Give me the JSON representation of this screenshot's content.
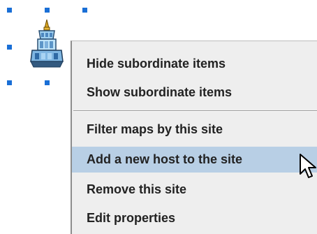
{
  "canvas": {
    "node_icon": "site-tower-icon",
    "selection_color": "#1a6fd6"
  },
  "context_menu": {
    "items": [
      {
        "label": "Hide subordinate items"
      },
      {
        "label": "Show subordinate items"
      },
      {
        "label": "Filter maps by this site"
      },
      {
        "label": "Add a new host to the site",
        "highlighted": true
      },
      {
        "label": "Remove this site"
      },
      {
        "label": "Edit properties"
      }
    ],
    "highlight_color": "#b8cfe5"
  },
  "cursor": {
    "icon": "mouse-pointer-icon"
  }
}
